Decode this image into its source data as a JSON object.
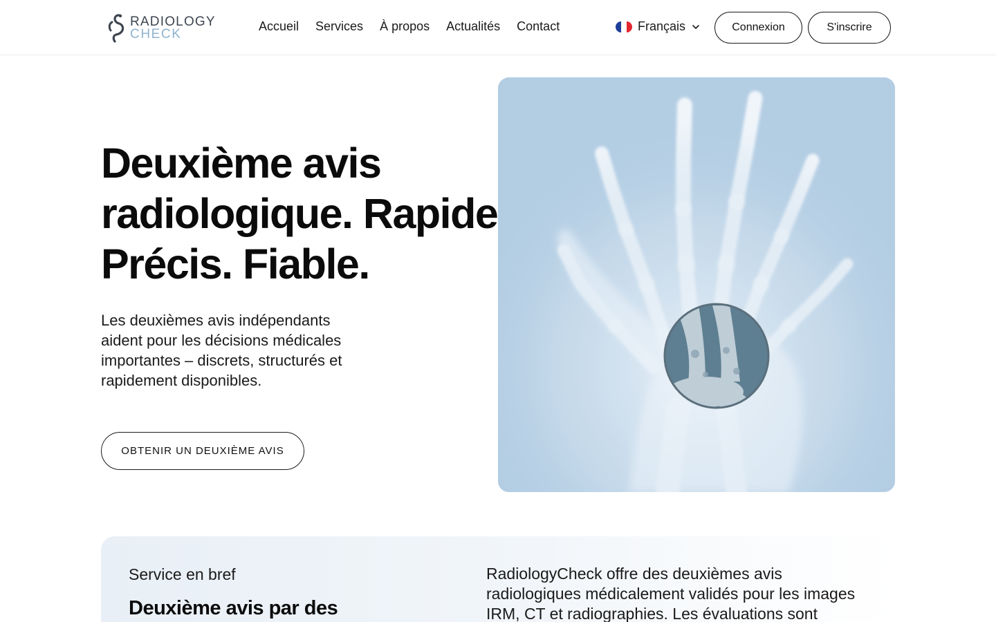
{
  "brand": {
    "line1": "RADIOLOGY",
    "line2": "CHECK",
    "colors": {
      "dark": "#3e4650",
      "accent": "#8fb3cf"
    }
  },
  "nav": {
    "items": [
      {
        "label": "Accueil"
      },
      {
        "label": "Services"
      },
      {
        "label": "À propos"
      },
      {
        "label": "Actualités"
      },
      {
        "label": "Contact"
      }
    ]
  },
  "language": {
    "selected": "Français",
    "flag_icon": "flag-fr-icon",
    "flag_colors": [
      "#1d3f9a",
      "#ffffff",
      "#e3262f"
    ]
  },
  "auth": {
    "login_label": "Connexion",
    "signup_label": "S'inscrire"
  },
  "hero": {
    "title_lines": [
      "Deuxième avis",
      "radiologique. Rapide.",
      "Précis. Fiable."
    ],
    "subtitle": "Les deuxièmes avis indépendants aident pour les décisions médicales importantes – discrets, structurés et rapidement disponibles.",
    "cta_label": "OBTENIR UN DEUXIÈME AVIS",
    "image_icon": "hand-xray-image",
    "image_bg": "#b3cde3"
  },
  "brief": {
    "eyebrow": "Service en bref",
    "heading": "Deuxième avis par des",
    "text": "RadiologyCheck offre des deuxièmes avis radiologiques médicalement validés pour les images IRM, CT et radiographies. Les évaluations sont"
  }
}
